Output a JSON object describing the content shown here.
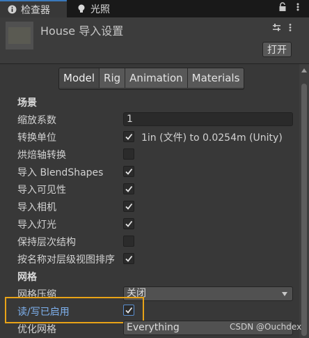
{
  "tabs": {
    "inspector": "检查器",
    "lighting": "光照"
  },
  "asset": {
    "title": "House 导入设置",
    "open_button": "打开"
  },
  "model_tabs": [
    "Model",
    "Rig",
    "Animation",
    "Materials"
  ],
  "sections": {
    "scene": "场景",
    "meshes": "网格"
  },
  "rows": {
    "scale_factor": {
      "label": "缩放系数",
      "value": "1"
    },
    "convert_units": {
      "label": "转换单位",
      "checked": true,
      "text": "1in (文件) to 0.0254m (Unity)"
    },
    "bake_axis": {
      "label": "烘焙轴转换",
      "checked": false
    },
    "import_blendshapes": {
      "label": "导入 BlendShapes",
      "checked": true
    },
    "import_visibility": {
      "label": "导入可见性",
      "checked": true
    },
    "import_cameras": {
      "label": "导入相机",
      "checked": true
    },
    "import_lights": {
      "label": "导入灯光",
      "checked": true
    },
    "preserve_hierarchy": {
      "label": "保持层次结构",
      "checked": false
    },
    "sort_hierarchy": {
      "label": "按名称对层级视图排序",
      "checked": true
    },
    "mesh_compression": {
      "label": "网格压缩",
      "value": "关闭"
    },
    "read_write": {
      "label": "读/写已启用",
      "checked": true
    },
    "optimize_mesh": {
      "label": "优化网格",
      "value": "Everything"
    }
  },
  "watermark": "CSDN @Ouchdex",
  "colors": {
    "highlight_border": "#e8a317",
    "active_tab_accent": "#3a79bb",
    "highlighted_label": "#7fb2f0"
  }
}
